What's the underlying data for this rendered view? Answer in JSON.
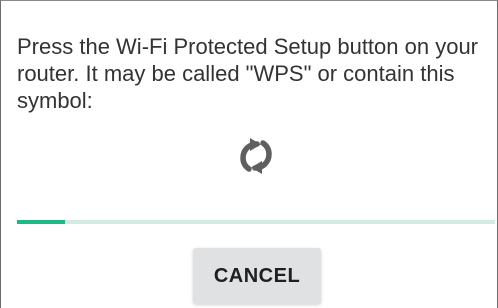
{
  "dialog": {
    "message": "Press the Wi-Fi Protected Setup button on your router. It may be called \"WPS\" or contain this symbol:",
    "icon": "wps-icon",
    "progress": 0.1,
    "cancel_label": "CANCEL",
    "colors": {
      "text": "#333333",
      "icon": "#5f5f5f",
      "progress_fill": "#1db884",
      "progress_track": "#d4ebe3",
      "button_bg": "#dfe1e2"
    }
  }
}
